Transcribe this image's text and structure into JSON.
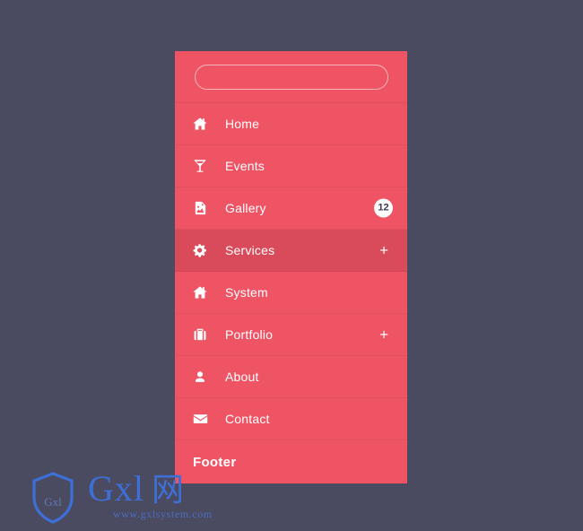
{
  "background_color": "#4a4b60",
  "menu": {
    "accent_color": "#ef5464",
    "active_color": "#d94a5a",
    "search": {
      "value": "",
      "placeholder": ""
    },
    "items": [
      {
        "icon": "home-icon",
        "label": "Home",
        "badge": null,
        "expander": null,
        "active": false
      },
      {
        "icon": "cocktail-icon",
        "label": "Events",
        "badge": null,
        "expander": null,
        "active": false
      },
      {
        "icon": "image-file-icon",
        "label": "Gallery",
        "badge": "12",
        "expander": null,
        "active": false
      },
      {
        "icon": "gear-icon",
        "label": "Services",
        "badge": null,
        "expander": "+",
        "active": true
      },
      {
        "icon": "home-icon",
        "label": "System",
        "badge": null,
        "expander": null,
        "active": false
      },
      {
        "icon": "briefcase-icon",
        "label": "Portfolio",
        "badge": null,
        "expander": "+",
        "active": false
      },
      {
        "icon": "user-icon",
        "label": "About",
        "badge": null,
        "expander": null,
        "active": false
      },
      {
        "icon": "envelope-icon",
        "label": "Contact",
        "badge": null,
        "expander": null,
        "active": false
      }
    ],
    "footer_label": "Footer"
  },
  "watermark": {
    "shield_text": "Gxl",
    "wordmark": "Gxl",
    "wordmark_cn": "网",
    "url": "www.gxlsystem.com",
    "color": "#3d6fd6"
  }
}
